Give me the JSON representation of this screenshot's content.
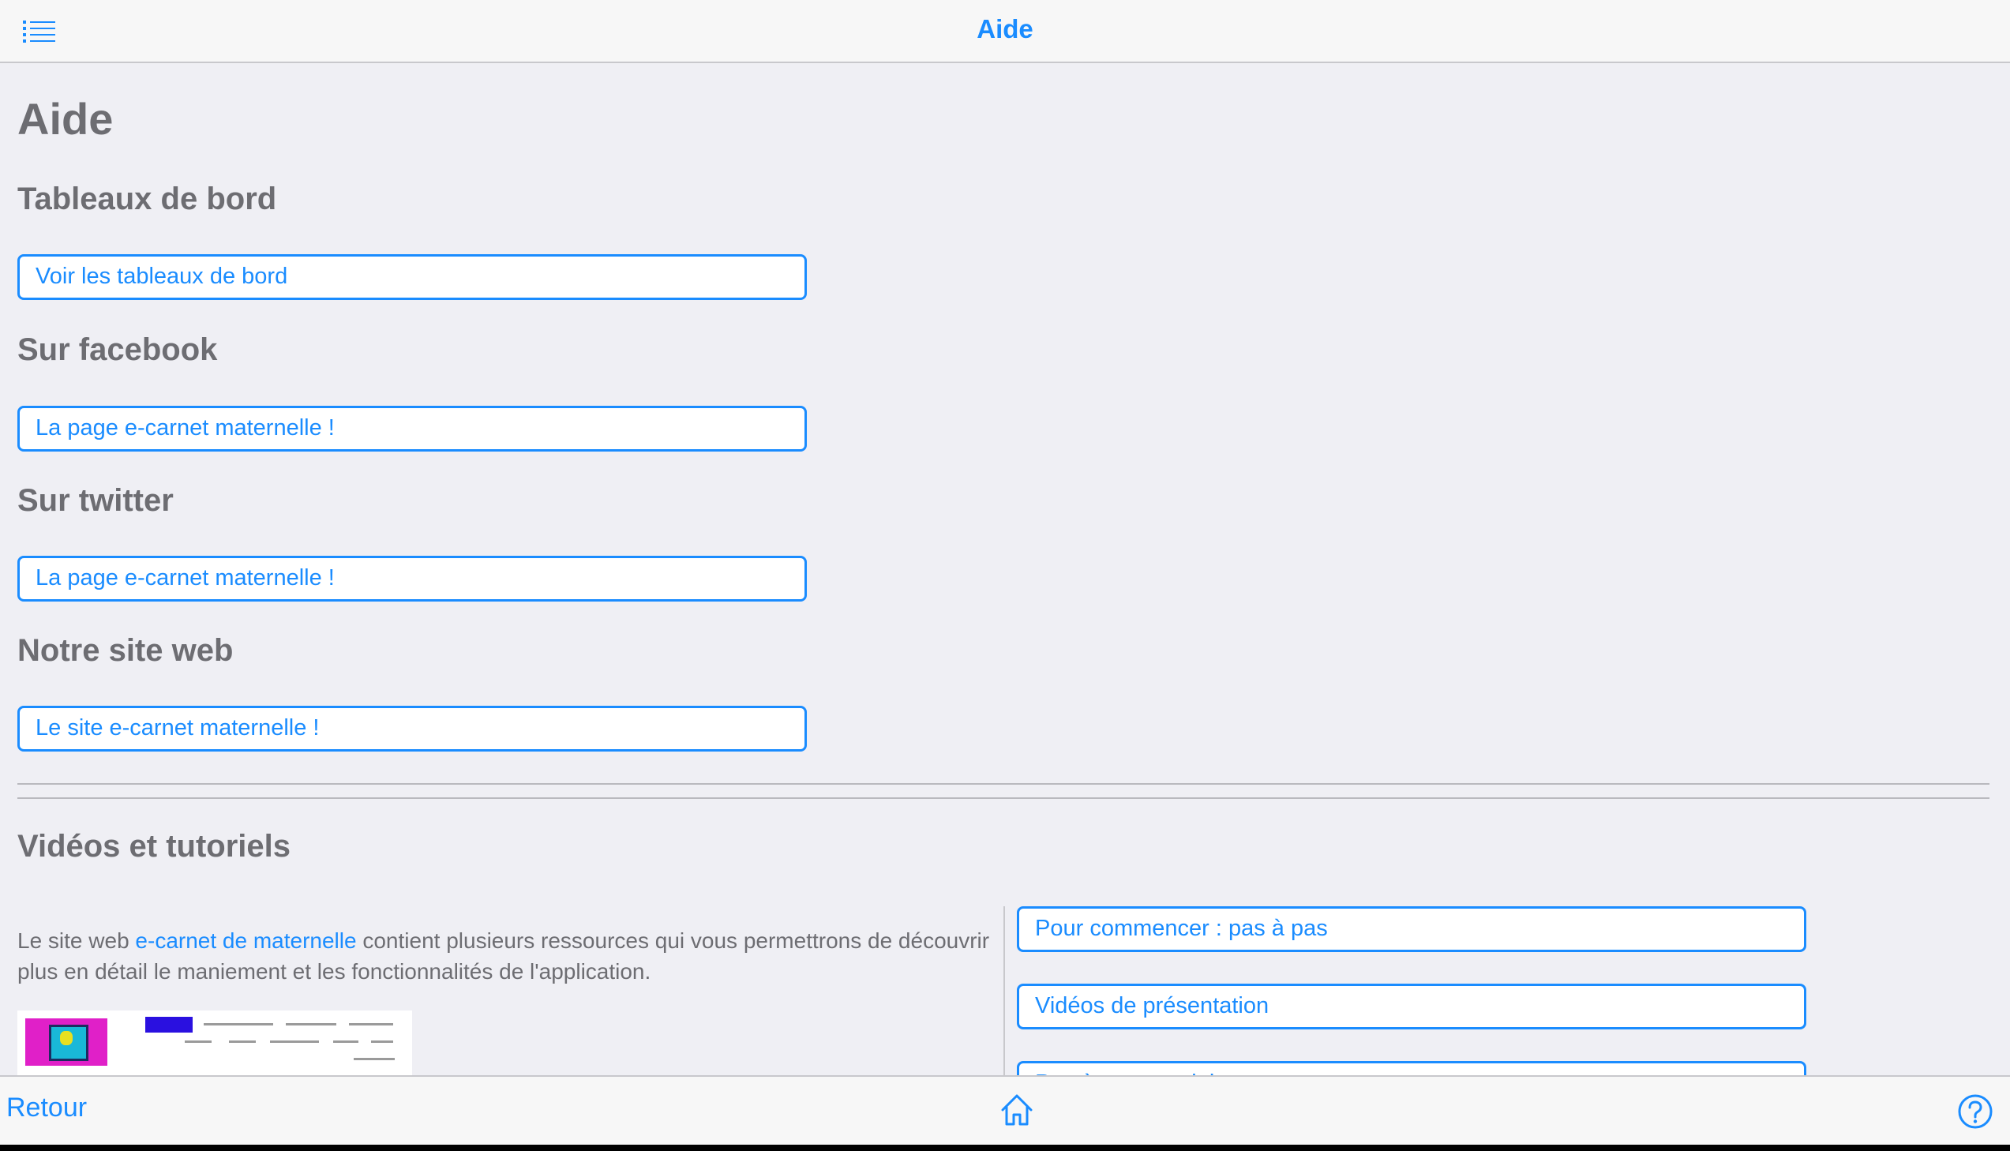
{
  "header": {
    "title": "Aide",
    "menu_icon": "list-icon"
  },
  "page": {
    "title": "Aide"
  },
  "sections": [
    {
      "title": "Tableaux de bord",
      "button_label": "Voir les tableaux de bord"
    },
    {
      "title": "Sur facebook",
      "button_label": "La page e-carnet maternelle !"
    },
    {
      "title": "Sur twitter",
      "button_label": "La page e-carnet maternelle !"
    },
    {
      "title": "Notre site web",
      "button_label": "Le site e-carnet maternelle !"
    }
  ],
  "videos": {
    "title": "Vidéos et tutoriels",
    "intro_before": "Le site web ",
    "intro_link": "e-carnet de maternelle",
    "intro_after": " contient plusieurs ressources qui vous permettrons de découvrir plus en détail le maniement et les fonctionnalités de l'application.",
    "buttons": [
      {
        "label": "Pour commencer : pas à pas"
      },
      {
        "label": "Vidéos de présentation"
      },
      {
        "label": "Pas-à-pas tutoriels"
      }
    ]
  },
  "footer": {
    "back_label": "Retour",
    "home_icon": "home-icon",
    "help_icon": "help-icon"
  },
  "colors": {
    "accent": "#1a8cff",
    "background": "#efeff4",
    "text_muted": "#6d6d72"
  }
}
